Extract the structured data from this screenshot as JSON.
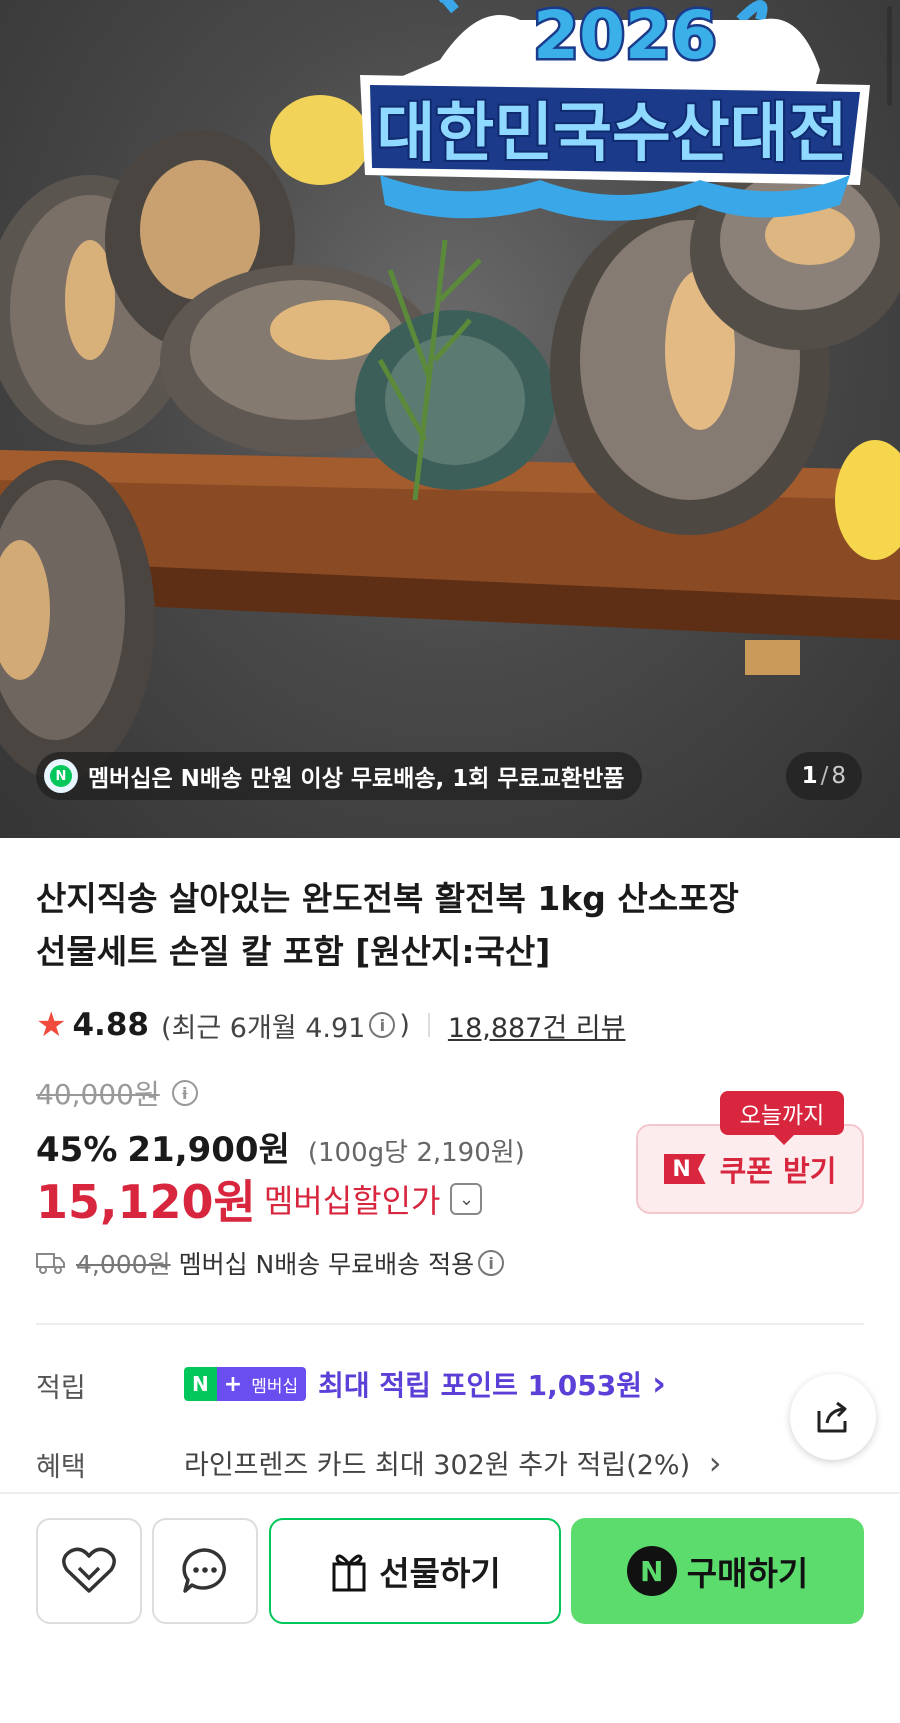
{
  "hero": {
    "banner_year": "2026",
    "banner_title": "대한민국수산대전",
    "promo_text": "멤버십은 N배송 만원 이상 무료배송, 1회 무료교환반품",
    "image_index": "1",
    "image_total": "8"
  },
  "product": {
    "title_line1": "산지직송 살아있는 완도전복 활전복 1kg 산소포장",
    "title_line2": "선물세트 손질 칼 포함 [원산지:국산]",
    "rating": "4.88",
    "recent_rating": "(최근 6개월 4.91",
    "recent_close": ")",
    "review_count": "18,887건 리뷰"
  },
  "price": {
    "original": "40,000원",
    "discount_pct": "45%",
    "sale_price": "21,900원",
    "unit_price": "(100g당 2,190원)",
    "member_price": "15,120원",
    "member_label": "멤버십할인가"
  },
  "coupon": {
    "badge": "오늘까지",
    "label": "쿠폰 받기",
    "logo": "N"
  },
  "shipping": {
    "old_fee": "4,000원",
    "text": "멤버십 N배송 무료배송 적용"
  },
  "points": {
    "label": "적립",
    "badge_n": "N",
    "badge_plus": "+",
    "badge_member": "멤버십",
    "text": "최대 적립 포인트 1,053원",
    "chevron": "›"
  },
  "benefit": {
    "label": "혜택",
    "text": "라인프렌즈 카드 최대 302원 추가 적립(2%)",
    "chevron": "›"
  },
  "actions": {
    "gift_label": "선물하기",
    "buy_label": "구매하기",
    "buy_icon": "N"
  },
  "colors": {
    "accent_red": "#d7263d",
    "naver_green": "#03c75a",
    "buy_button": "#5ddc6e",
    "points_purple": "#5b3fd6"
  }
}
